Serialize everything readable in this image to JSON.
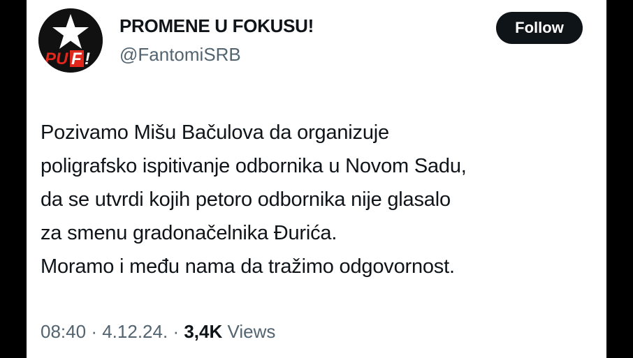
{
  "author": {
    "display_name": "PROMENE U FOKUSU!",
    "handle": "@FantomiSRB",
    "avatar_logo_text": "PUF!"
  },
  "follow_button": {
    "label": "Follow"
  },
  "tweet": {
    "lines": [
      "Pozivamo Mišu Bačulova da organizuje",
      "poligrafsko ispitivanje odbornika u Novom Sadu,",
      "da se utvrdi kojih petoro odbornika nije glasalo",
      "za smenu gradonačelnika Đurića.",
      "Moramo i među nama da tražimo odgovornost."
    ]
  },
  "meta": {
    "time": "08:40",
    "separator": "·",
    "date": "4.12.24.",
    "views_count": "3,4K",
    "views_label": "Views"
  },
  "colors": {
    "text_primary": "#0f1419",
    "text_secondary": "#536471",
    "button_bg": "#0f1419",
    "logo_red": "#e1261c"
  }
}
